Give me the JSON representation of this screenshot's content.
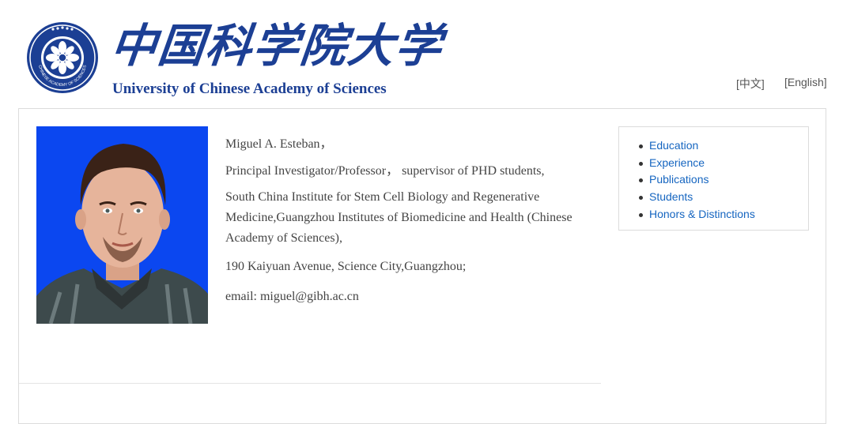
{
  "header": {
    "logo_seal_text": "UNIVERSITY OF CHINESE ACADEMY OF SCIENCES",
    "cn_title": "中国科学院大学",
    "en_title": "University of  Chinese Academy of Sciences",
    "lang_links": [
      "[中文]",
      "[English]"
    ]
  },
  "profile": {
    "name": "Miguel A. Esteban，",
    "title": "Principal Investigator/Professor， supervisor of PHD students,",
    "institution": "South China Institute for Stem Cell Biology and Regenerative Medicine,Guangzhou Institutes of Biomedicine and Health (Chinese Academy of Sciences),",
    "address": "190 Kaiyuan Avenue, Science City,Guangzhou;",
    "email": "email: miguel@gibh.ac.cn"
  },
  "nav": {
    "items": [
      "Education",
      "Experience",
      "Publications",
      "Students",
      "Honors & Distinctions"
    ]
  },
  "colors": {
    "brand_blue": "#1c3f94",
    "link_blue": "#1565c0",
    "photo_bg": "#0b47f0"
  }
}
